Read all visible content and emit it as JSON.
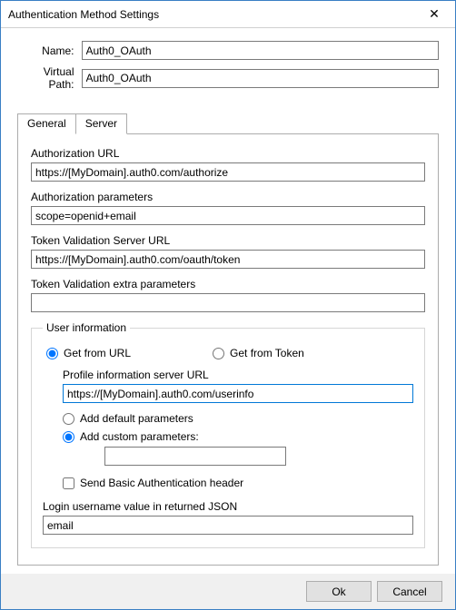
{
  "window": {
    "title": "Authentication Method Settings",
    "close_icon": "✕"
  },
  "form": {
    "name_label": "Name:",
    "name_value": "Auth0_OAuth",
    "vpath_label": "Virtual Path:",
    "vpath_value": "Auth0_OAuth"
  },
  "tabs": {
    "general": "General",
    "server": "Server"
  },
  "server": {
    "auth_url_label": "Authorization URL",
    "auth_url_value": "https://[MyDomain].auth0.com/authorize",
    "auth_params_label": "Authorization parameters",
    "auth_params_value": "scope=openid+email",
    "token_url_label": "Token Validation Server URL",
    "token_url_value": "https://[MyDomain].auth0.com/oauth/token",
    "token_extra_label": "Token Validation extra parameters",
    "token_extra_value": ""
  },
  "userinfo": {
    "legend": "User information",
    "get_from_url_label": "Get from URL",
    "get_from_token_label": "Get from Token",
    "profile_url_label": "Profile information server URL",
    "profile_url_value": "https://[MyDomain].auth0.com/userinfo",
    "add_default_label": "Add default parameters",
    "add_custom_label": "Add custom parameters:",
    "custom_params_value": "",
    "send_basic_auth_label": "Send Basic Authentication header",
    "login_json_label": "Login username value in returned JSON",
    "login_json_value": "email"
  },
  "buttons": {
    "ok": "Ok",
    "cancel": "Cancel"
  }
}
